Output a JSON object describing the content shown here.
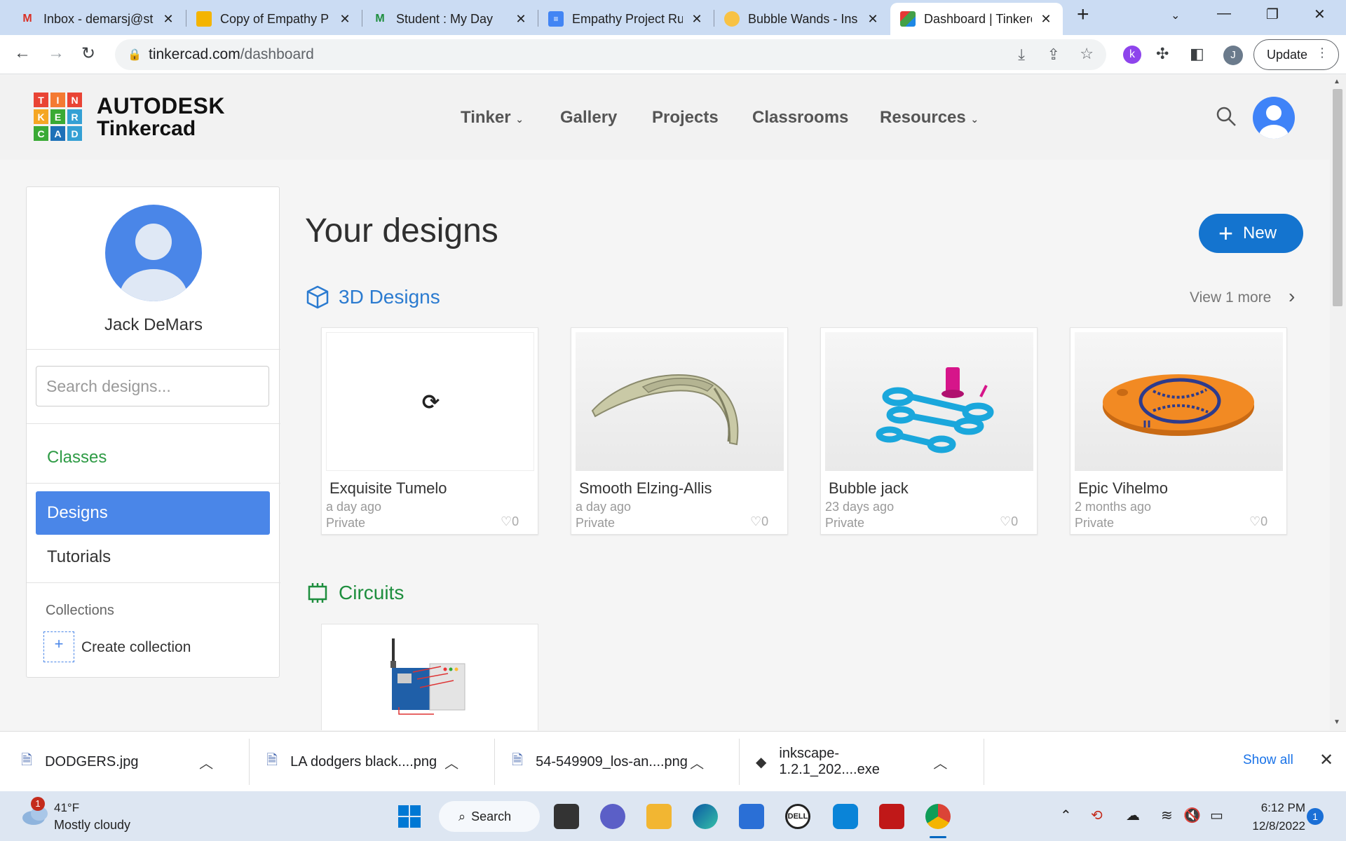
{
  "browser": {
    "tabs": [
      {
        "title": "Inbox - demarsj@st",
        "icon": "gmail-icon"
      },
      {
        "title": "Copy of Empathy P",
        "icon": "slides-icon"
      },
      {
        "title": "Student : My Day",
        "icon": "myday-icon"
      },
      {
        "title": "Empathy Project Ru",
        "icon": "docs-icon"
      },
      {
        "title": "Bubble Wands - Ins",
        "icon": "instructables-icon"
      },
      {
        "title": "Dashboard | Tinkerc",
        "icon": "tinkercad-icon"
      }
    ],
    "url_domain": "tinkercad.com",
    "url_path": "/dashboard",
    "profile_initial": "J",
    "update_label": "Update"
  },
  "header": {
    "brand_line1": "AUTODESK",
    "brand_line2": "Tinkercad",
    "logo_letters": [
      "T",
      "I",
      "N",
      "K",
      "E",
      "R",
      "C",
      "A",
      "D"
    ],
    "nav": [
      {
        "label": "Tinker",
        "has_dropdown": true
      },
      {
        "label": "Gallery",
        "has_dropdown": false
      },
      {
        "label": "Projects",
        "has_dropdown": false
      },
      {
        "label": "Classrooms",
        "has_dropdown": false
      },
      {
        "label": "Resources",
        "has_dropdown": true
      }
    ]
  },
  "sidebar": {
    "user_name": "Jack DeMars",
    "search_placeholder": "Search designs...",
    "classes_label": "Classes",
    "designs_label": "Designs",
    "tutorials_label": "Tutorials",
    "collections_label": "Collections",
    "create_collection_label": "Create collection"
  },
  "main": {
    "title": "Your designs",
    "new_label": "New",
    "section_3d": "3D Designs",
    "view_more": "View 1 more",
    "section_circuits": "Circuits",
    "designs": [
      {
        "title": "Exquisite Tumelo",
        "time": "a day ago",
        "privacy": "Private",
        "likes": "0"
      },
      {
        "title": "Smooth Elzing-Allis",
        "time": "a day ago",
        "privacy": "Private",
        "likes": "0"
      },
      {
        "title": "Bubble jack",
        "time": "23 days ago",
        "privacy": "Private",
        "likes": "0"
      },
      {
        "title": "Epic Vihelmo",
        "time": "2 months ago",
        "privacy": "Private",
        "likes": "0"
      }
    ]
  },
  "downloads": {
    "items": [
      "DODGERS.jpg",
      "LA dodgers black....png",
      "54-549909_los-an....png",
      "inkscape-1.2.1_202....exe"
    ],
    "show_all": "Show all"
  },
  "taskbar": {
    "weather_badge": "1",
    "temp": "41°F",
    "weather_desc": "Mostly cloudy",
    "search_label": "Search",
    "time": "6:12 PM",
    "date": "12/8/2022",
    "notifications": "1"
  },
  "colors": {
    "primary_blue": "#4a86e8",
    "new_button": "#1474cf",
    "section_3d": "#2b7bd0",
    "section_circuits": "#1e8e3e",
    "classes_link": "#2e9b45"
  }
}
